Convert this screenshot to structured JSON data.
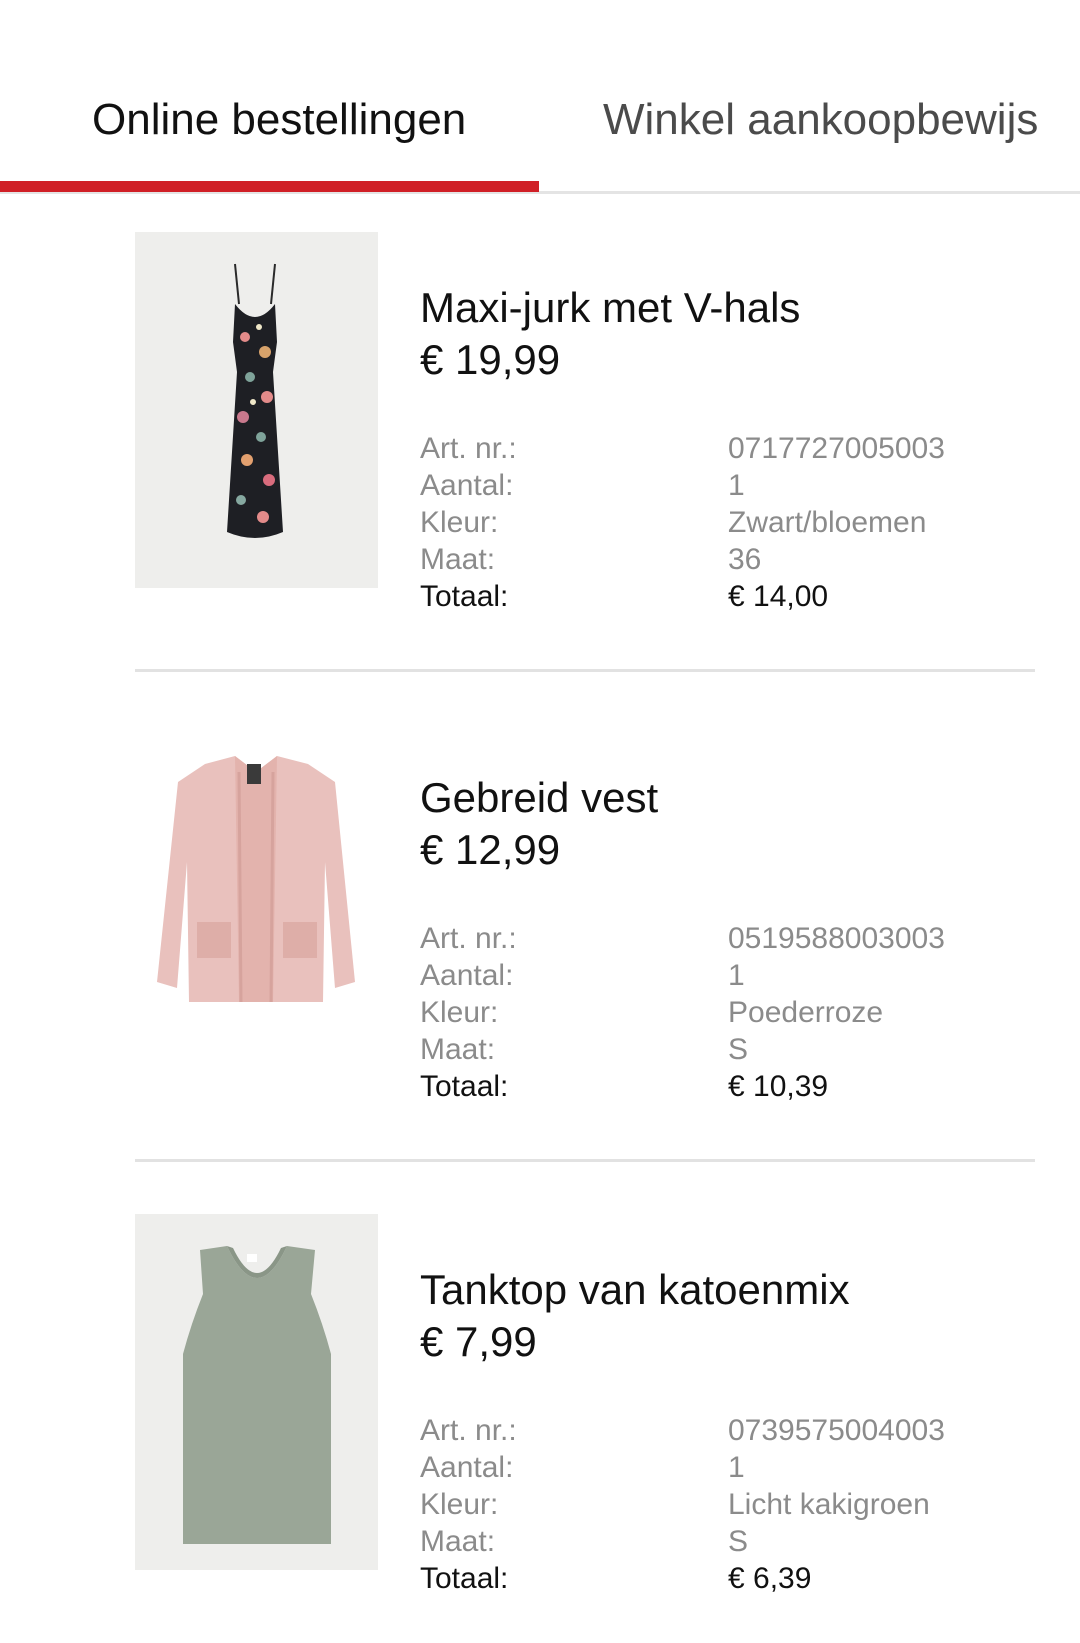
{
  "tabs": {
    "online_label": "Online bestellingen",
    "store_label": "Winkel aankoopbewijs",
    "active": "online",
    "accent_color": "#d01f26"
  },
  "products": [
    {
      "name": "Maxi-jurk met V-hals",
      "price": "€ 19,99",
      "image_icon": "floral-maxi-dress-image",
      "art_label": "Art. nr.:",
      "art_value": "0717727005003",
      "qty_label": "Aantal:",
      "qty_value": "1",
      "color_label": "Kleur:",
      "color_value": "Zwart/bloemen",
      "size_label": "Maat:",
      "size_value": "36",
      "total_label": "Totaal:",
      "total_value": "€ 14,00"
    },
    {
      "name": "Gebreid vest",
      "price": "€ 12,99",
      "image_icon": "pink-cardigan-image",
      "art_label": "Art. nr.:",
      "art_value": "0519588003003",
      "qty_label": "Aantal:",
      "qty_value": "1",
      "color_label": "Kleur:",
      "color_value": "Poederroze",
      "size_label": "Maat:",
      "size_value": "S",
      "total_label": "Totaal:",
      "total_value": "€ 10,39"
    },
    {
      "name": "Tanktop van katoenmix",
      "price": "€ 7,99",
      "image_icon": "green-tanktop-image",
      "art_label": "Art. nr.:",
      "art_value": "0739575004003",
      "qty_label": "Aantal:",
      "qty_value": "1",
      "color_label": "Kleur:",
      "color_value": "Licht kakigroen",
      "size_label": "Maat:",
      "size_value": "S",
      "total_label": "Totaal:",
      "total_value": "€ 6,39"
    }
  ]
}
